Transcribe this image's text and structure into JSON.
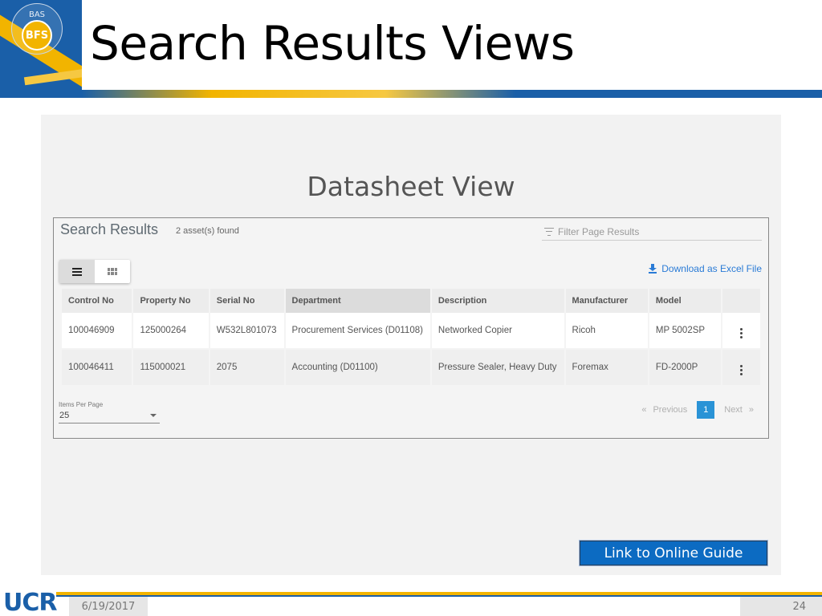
{
  "header": {
    "logo_small": "BAS",
    "logo_badge": "BFS",
    "title": "Search Results Views"
  },
  "panel": {
    "label": "Datasheet View"
  },
  "search_results": {
    "title": "Search Results",
    "count": "2 asset(s) found",
    "filter_placeholder": "Filter Page Results",
    "download_label": "Download as Excel File",
    "columns": [
      "Control No",
      "Property No",
      "Serial No",
      "Department",
      "Description",
      "Manufacturer",
      "Model"
    ],
    "rows": [
      [
        "100046909",
        "125000264",
        "W532L801073",
        "Procurement Services (D01108)",
        "Networked Copier",
        "Ricoh",
        "MP 5002SP"
      ],
      [
        "100046411",
        "115000021",
        "2075",
        "Accounting (D01100)",
        "Pressure Sealer, Heavy Duty",
        "Foremax",
        "FD-2000P"
      ]
    ],
    "items_per_page_label": "Items Per Page",
    "items_per_page_value": "25",
    "pagination": {
      "first": "«",
      "previous": "Previous",
      "current": "1",
      "next": "Next",
      "last": "»"
    }
  },
  "guide_link": "Link to Online Guide",
  "footer": {
    "logo": "UCR",
    "date": "6/19/2017",
    "page": "24"
  },
  "colors": {
    "brand_blue": "#1a5fa8",
    "brand_gold": "#f2b400",
    "link_blue": "#2a7bd6",
    "page_active": "#2a93d6"
  }
}
